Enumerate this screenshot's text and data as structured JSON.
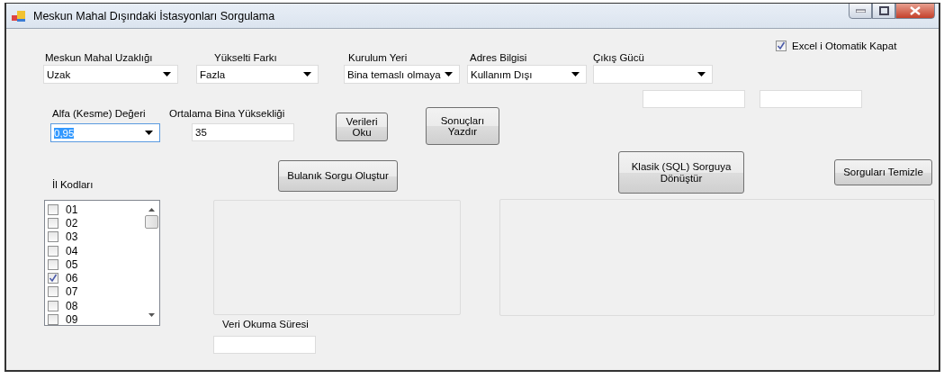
{
  "window": {
    "title": "Meskun Mahal Dışındaki İstasyonları Sorgulama"
  },
  "dropdowns": [
    {
      "label": "Meskun Mahal Uzaklığı",
      "value": "Uzak"
    },
    {
      "label": "Yükselti Farkı",
      "value": "Fazla"
    },
    {
      "label": "Kurulum Yeri",
      "value": "Bina temaslı olmaya"
    },
    {
      "label": "Adres Bilgisi",
      "value": "Kullanım Dışı"
    },
    {
      "label": "Çıkış Gücü"
    }
  ],
  "excel_checkbox": {
    "label": "Excel i Otomatik Kapat",
    "checked": true
  },
  "alfa": {
    "label": "Alfa (Kesme) Değeri",
    "value": "0,95"
  },
  "height": {
    "label": "Ortalama Bina Yüksekliği",
    "value": "35"
  },
  "buttons": [
    {
      "label": "Verileri Oku"
    },
    {
      "label": "Sonuçları Yazdır"
    },
    {
      "label": "Bulanık Sorgu Oluştur"
    },
    {
      "label": "Klasik (SQL) Sorguya Dönüştür"
    },
    {
      "label": "Sorguları Temizle"
    }
  ],
  "il_kodlari": {
    "label": "İl Kodları",
    "items": [
      {
        "label": "01",
        "checked": false
      },
      {
        "label": "02",
        "checked": false
      },
      {
        "label": "03",
        "checked": false
      },
      {
        "label": "04",
        "checked": false
      },
      {
        "label": "05",
        "checked": false
      },
      {
        "label": "06",
        "checked": true
      },
      {
        "label": "07",
        "checked": false
      },
      {
        "label": "08",
        "checked": false
      },
      {
        "label": "09",
        "checked": false
      }
    ]
  },
  "read_time": {
    "label": "Veri Okuma Süresi"
  }
}
